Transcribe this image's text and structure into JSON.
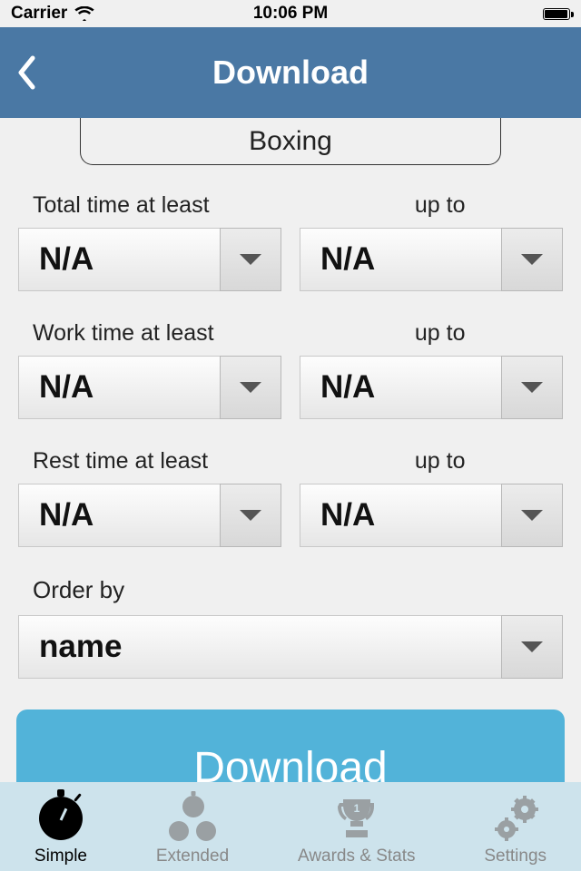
{
  "statusBar": {
    "carrier": "Carrier",
    "time": "10:06 PM"
  },
  "nav": {
    "title": "Download"
  },
  "category": {
    "label": "Boxing"
  },
  "filters": {
    "totalTime": {
      "labelLeft": "Total time at least",
      "labelRight": "up to",
      "valueLeft": "N/A",
      "valueRight": "N/A"
    },
    "workTime": {
      "labelLeft": "Work time at least",
      "labelRight": "up to",
      "valueLeft": "N/A",
      "valueRight": "N/A"
    },
    "restTime": {
      "labelLeft": "Rest time at least",
      "labelRight": "up to",
      "valueLeft": "N/A",
      "valueRight": "N/A"
    }
  },
  "orderBy": {
    "label": "Order by",
    "value": "name"
  },
  "actions": {
    "download": "Download"
  },
  "tabs": {
    "simple": "Simple",
    "extended": "Extended",
    "awardsStats": "Awards & Stats",
    "settings": "Settings"
  }
}
